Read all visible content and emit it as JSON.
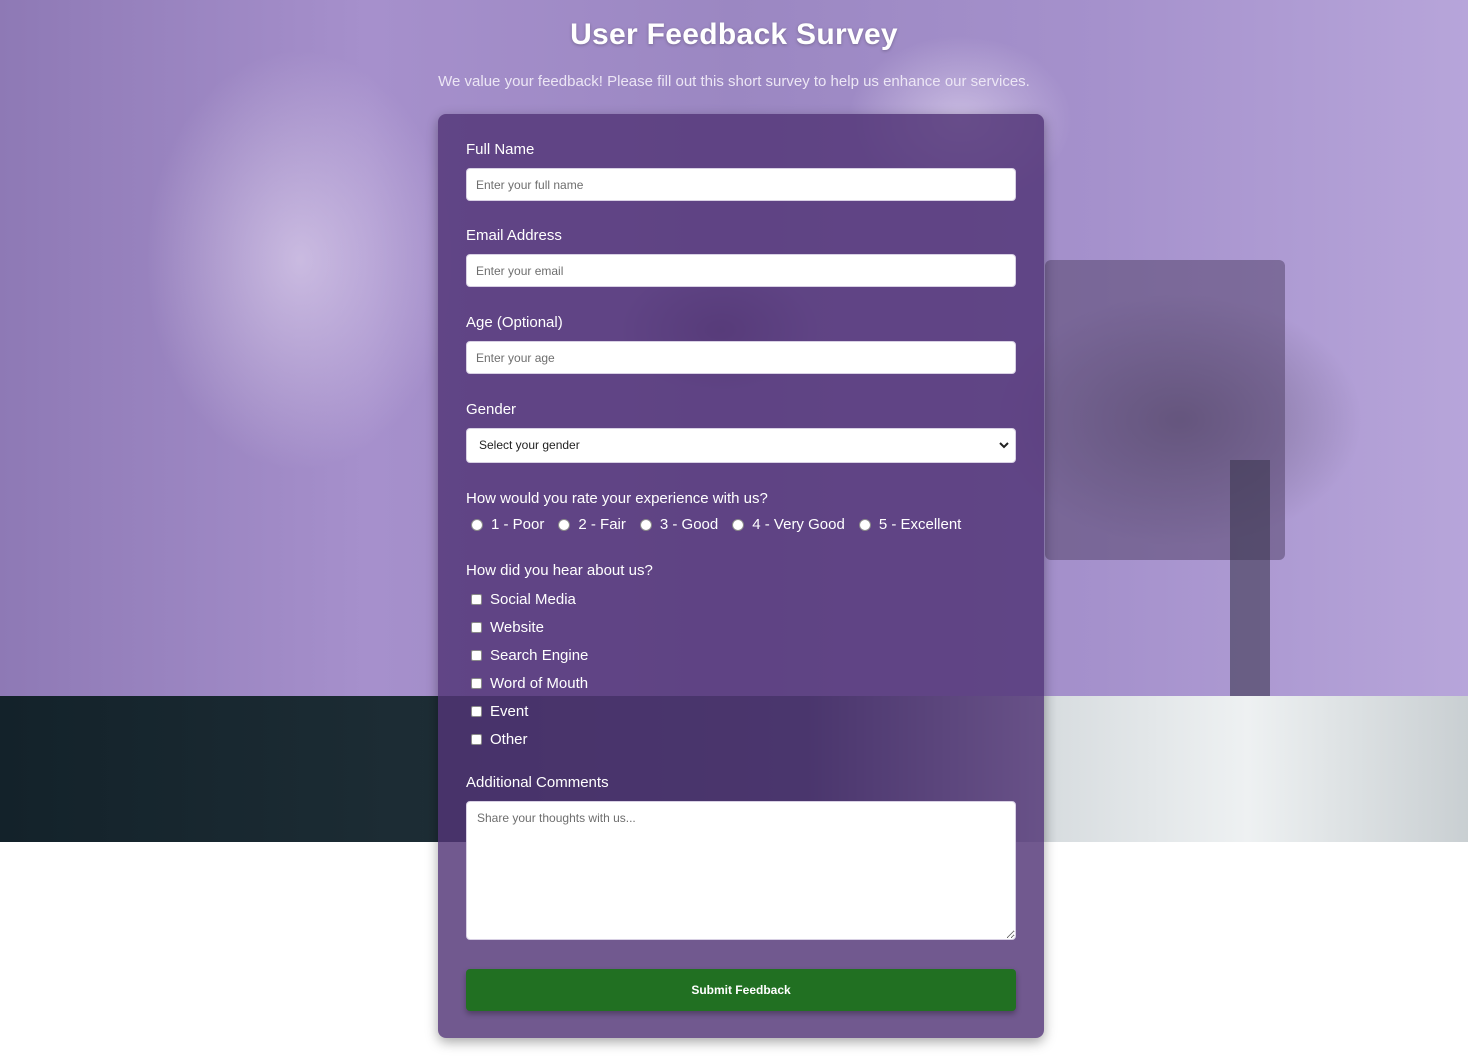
{
  "header": {
    "title": "User Feedback Survey",
    "subtitle": "We value your feedback! Please fill out this short survey to help us enhance our services."
  },
  "form": {
    "full_name": {
      "label": "Full Name",
      "placeholder": "Enter your full name",
      "value": ""
    },
    "email": {
      "label": "Email Address",
      "placeholder": "Enter your email",
      "value": ""
    },
    "age": {
      "label": "Age (Optional)",
      "placeholder": "Enter your age",
      "value": ""
    },
    "gender": {
      "label": "Gender",
      "selected": "Select your gender"
    },
    "rating": {
      "label": "How would you rate your experience with us?",
      "options": [
        "1 - Poor",
        "2 - Fair",
        "3 - Good",
        "4 - Very Good",
        "5 - Excellent"
      ]
    },
    "source": {
      "label": "How did you hear about us?",
      "options": [
        "Social Media",
        "Website",
        "Search Engine",
        "Word of Mouth",
        "Event",
        "Other"
      ]
    },
    "comments": {
      "label": "Additional Comments",
      "placeholder": "Share your thoughts with us...",
      "value": ""
    },
    "submit_label": "Submit Feedback"
  },
  "colors": {
    "card_background": "#523476",
    "submit_button": "#217022",
    "title_text": "#ffffff"
  }
}
